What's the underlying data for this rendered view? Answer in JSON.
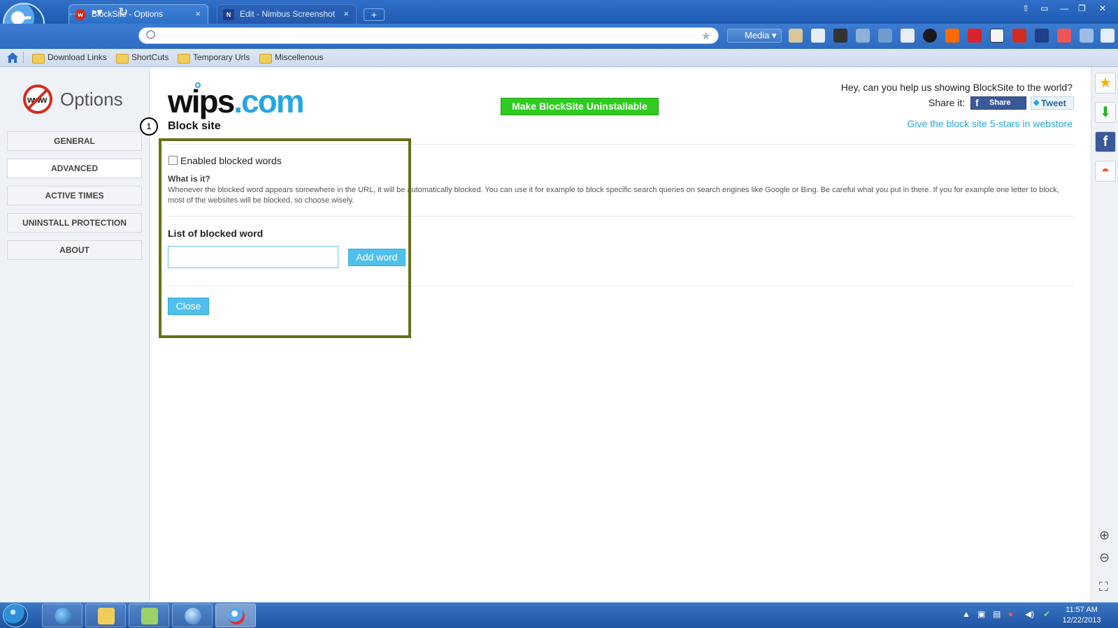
{
  "browser": {
    "tabs": [
      {
        "title": "BlockSite - Options",
        "active": true
      },
      {
        "title": "Edit - Nimbus Screenshot",
        "active": false
      }
    ],
    "new_tab_label": "+",
    "tab_close_glyph": "×",
    "url_value": "",
    "media_label": "Media",
    "bookmarks": [
      "Download Links",
      "ShortCuts",
      "Temporary Urls",
      "Miscellenous"
    ]
  },
  "sidebar": {
    "title": "Options",
    "logo_text": "www",
    "items": [
      {
        "label": "GENERAL",
        "active": false
      },
      {
        "label": "ADVANCED",
        "active": true
      },
      {
        "label": "ACTIVE TIMES",
        "active": false
      },
      {
        "label": "UNINSTALL PROTECTION",
        "active": false
      },
      {
        "label": "ABOUT",
        "active": false
      }
    ]
  },
  "header": {
    "brand_part1": "wips",
    "brand_part2": ".com",
    "uninstallable_button": "Make BlockSite Uninstallable",
    "help_text": "Hey, can you help us showing BlockSite to the world?",
    "share_label": "Share it:",
    "facebook_share": "Share",
    "tweet": "Tweet",
    "rate_link": "Give the block site 5-stars in webstore"
  },
  "section": {
    "step_badge": "1",
    "title": "Block site",
    "checkbox_label": "Enabled blocked words",
    "checkbox_checked": false,
    "what_is_it": "What is it?",
    "description": "Whenever the blocked word appears somewhere in the URL, it will be automatically blocked. You can use it for example to block specific search queries on search engines like Google or Bing. Be careful what you put in there. If you for example one letter to block, most of the websites will be blocked, so choose wisely.",
    "list_title": "List of blocked word",
    "word_input_value": "",
    "add_word_button": "Add word",
    "close_button": "Close"
  },
  "taskbar": {
    "time": "11:57 AM",
    "date": "12/22/2013"
  },
  "colors": {
    "accent": "#27a6e0",
    "green_button": "#2ecc1f",
    "highlight_border": "#676f1c",
    "chrome_blue": "#2e6cc2"
  }
}
